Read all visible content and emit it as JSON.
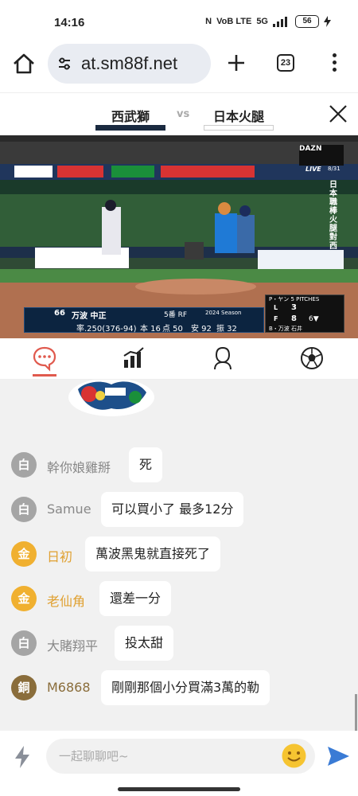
{
  "status_bar": {
    "time": "14:16",
    "network_1": "VoB LTE",
    "network_2": "5G",
    "battery": "56"
  },
  "browser": {
    "url": "at.sm88f.net",
    "tab_count": "23"
  },
  "match": {
    "home_team": "西武獅",
    "vs": "vs",
    "away_team": "日本火腿"
  },
  "video": {
    "broadcast_logo": "DAZN",
    "live_label": "LIVE",
    "date": "8/31",
    "vertical_caption": "日本職棒 火腿對西",
    "batter": {
      "number": "66",
      "name": "万波 中正",
      "position": "5番 RF",
      "season": "2024 Season",
      "avg": "率.250(376-94)",
      "hr": "本 16",
      "rbi": "点 50",
      "hits": "安 92",
      "sb": "振 32"
    },
    "score": {
      "pitcher_line": "P・ヤン  5 PITCHES",
      "team_l": "L",
      "score_l": "3",
      "team_f": "F",
      "score_f": "8",
      "inning": "6▼",
      "batter_line": "B・万波  石井"
    }
  },
  "tabs": [
    {
      "name": "chat",
      "icon": "chat-bubble-icon"
    },
    {
      "name": "stats",
      "icon": "bar-chart-icon"
    },
    {
      "name": "players",
      "icon": "person-icon"
    },
    {
      "name": "match",
      "icon": "soccer-ball-icon"
    }
  ],
  "messages": [
    {
      "badge": "白",
      "user": "幹你娘雞掰",
      "text": "死"
    },
    {
      "badge": "白",
      "user": "Samue",
      "text": "可以買小了  最多12分"
    },
    {
      "badge": "金",
      "user": "日初",
      "text": "萬波黑鬼就直接死了"
    },
    {
      "badge": "金",
      "user": "老仙角",
      "text": "還差一分"
    },
    {
      "badge": "白",
      "user": "大賭翔平",
      "text": "投太甜"
    },
    {
      "badge": "銅",
      "user": "M6868",
      "text": "剛剛那個小分買滿3萬的勒"
    }
  ],
  "input": {
    "placeholder": "一起聊聊吧~"
  },
  "colors": {
    "accent": "#e05a4e",
    "send": "#3a7bd5",
    "gold": "#f0b030",
    "bronze": "#8a6d3b",
    "white_badge": "#a5a5a5",
    "chat_bg": "#f1f1f1"
  }
}
